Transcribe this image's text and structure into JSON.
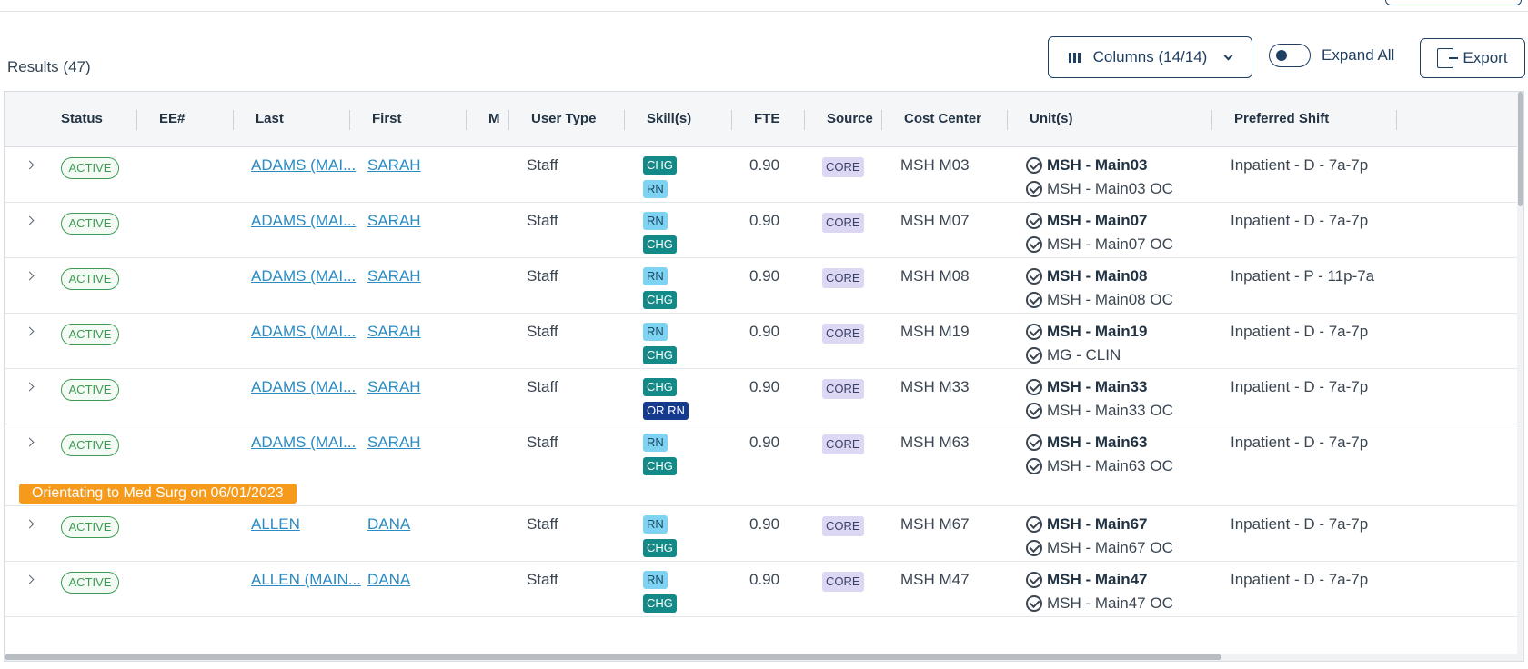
{
  "toolbar": {
    "results_label": "Results (47)",
    "columns_label": "Columns (14/14)",
    "expand_all_label": "Expand All",
    "export_label": "Export"
  },
  "table": {
    "headers": [
      "Status",
      "EE#",
      "Last",
      "First",
      "M",
      "User Type",
      "Skill(s)",
      "FTE",
      "Source",
      "Cost Center",
      "Unit(s)",
      "Preferred Shift"
    ],
    "rows": [
      {
        "status": "ACTIVE",
        "last": "ADAMS (MAI...",
        "first": "SARAH",
        "user_type": "Staff",
        "skills": [
          "CHG",
          "RN"
        ],
        "fte": "0.90",
        "source": "CORE",
        "cost_center": "MSH M03",
        "unit_primary": "MSH - Main03",
        "unit_secondary": "MSH - Main03 OC",
        "shift": "Inpatient - D - 7a-7p"
      },
      {
        "status": "ACTIVE",
        "last": "ADAMS (MAI...",
        "first": "SARAH",
        "user_type": "Staff",
        "skills": [
          "RN",
          "CHG"
        ],
        "fte": "0.90",
        "source": "CORE",
        "cost_center": "MSH M07",
        "unit_primary": "MSH - Main07",
        "unit_secondary": "MSH - Main07 OC",
        "shift": "Inpatient - D - 7a-7p"
      },
      {
        "status": "ACTIVE",
        "last": "ADAMS (MAI...",
        "first": "SARAH",
        "user_type": "Staff",
        "skills": [
          "RN",
          "CHG"
        ],
        "fte": "0.90",
        "source": "CORE",
        "cost_center": "MSH M08",
        "unit_primary": "MSH - Main08",
        "unit_secondary": "MSH - Main08 OC",
        "shift": "Inpatient - P - 11p-7a"
      },
      {
        "status": "ACTIVE",
        "last": "ADAMS (MAI...",
        "first": "SARAH",
        "user_type": "Staff",
        "skills": [
          "RN",
          "CHG"
        ],
        "fte": "0.90",
        "source": "CORE",
        "cost_center": "MSH M19",
        "unit_primary": "MSH - Main19",
        "unit_secondary": "MG - CLIN",
        "shift": "Inpatient - D - 7a-7p"
      },
      {
        "status": "ACTIVE",
        "last": "ADAMS (MAI...",
        "first": "SARAH",
        "user_type": "Staff",
        "skills": [
          "CHG",
          "OR RN"
        ],
        "fte": "0.90",
        "source": "CORE",
        "cost_center": "MSH M33",
        "unit_primary": "MSH - Main33",
        "unit_secondary": "MSH - Main33 OC",
        "shift": "Inpatient - D - 7a-7p"
      },
      {
        "status": "ACTIVE",
        "last": "ADAMS (MAI...",
        "first": "SARAH",
        "user_type": "Staff",
        "skills": [
          "RN",
          "CHG"
        ],
        "fte": "0.90",
        "source": "CORE",
        "cost_center": "MSH M63",
        "unit_primary": "MSH - Main63",
        "unit_secondary": "MSH - Main63 OC",
        "shift": "Inpatient - D - 7a-7p",
        "note": "Orientating to Med Surg on 06/01/2023"
      },
      {
        "status": "ACTIVE",
        "last": "ALLEN",
        "first": "DANA",
        "user_type": "Staff",
        "skills": [
          "RN",
          "CHG"
        ],
        "fte": "0.90",
        "source": "CORE",
        "cost_center": "MSH M67",
        "unit_primary": "MSH - Main67",
        "unit_secondary": "MSH - Main67 OC",
        "shift": "Inpatient - D - 7a-7p"
      },
      {
        "status": "ACTIVE",
        "last": "ALLEN (MAIN...",
        "first": "DANA",
        "user_type": "Staff",
        "skills": [
          "RN",
          "CHG"
        ],
        "fte": "0.90",
        "source": "CORE",
        "cost_center": "MSH M47",
        "unit_primary": "MSH - Main47",
        "unit_secondary": "MSH - Main47 OC",
        "shift": "Inpatient - D - 7a-7p"
      }
    ]
  },
  "colors": {
    "accent": "#1f3f62",
    "active": "#3d9a54",
    "link": "#2b8cc4",
    "chg": "#138a87",
    "rn": "#7fd3f2",
    "or_rn": "#153b8f",
    "core": "#dcd8f4",
    "note": "#f69a1c"
  }
}
